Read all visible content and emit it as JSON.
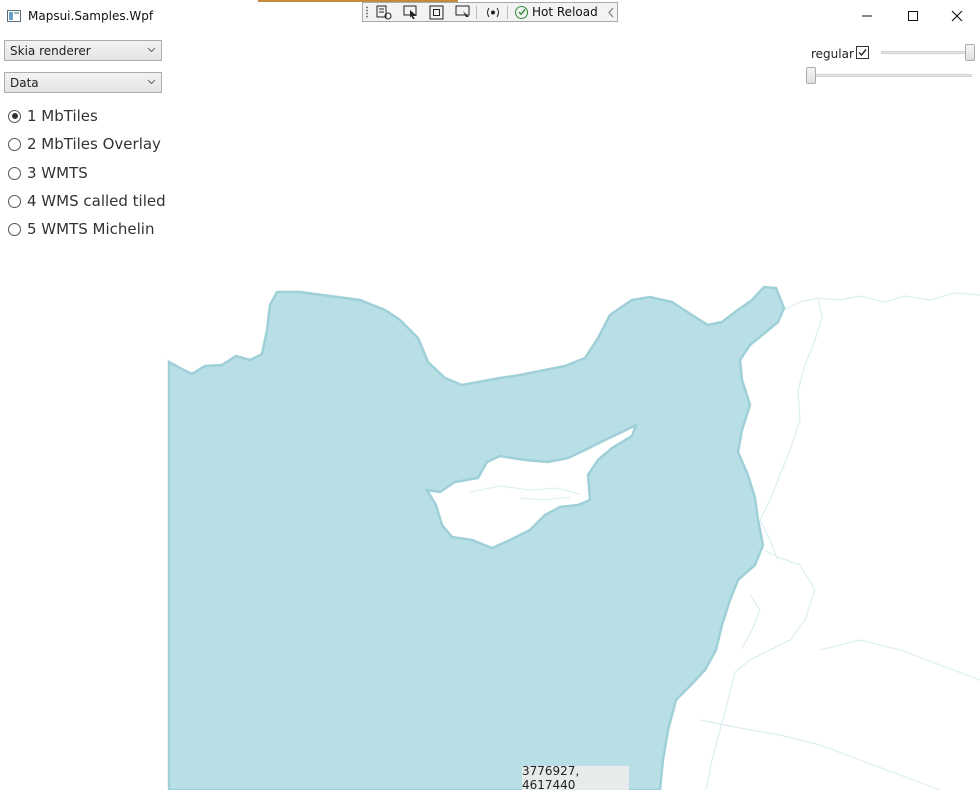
{
  "window": {
    "title": "Mapsui.Samples.Wpf",
    "minimize": "minimize-icon",
    "maximize": "maximize-icon",
    "close": "close-icon"
  },
  "debug_toolbar": {
    "hot_reload_label": "Hot Reload",
    "icons": [
      "live-visual-tree-icon",
      "select-element-icon",
      "display-layout-adorners-icon",
      "track-focus-icon",
      "binding-failures-icon",
      "hot-reload-check-icon",
      "collapse-chevron-icon"
    ]
  },
  "sidebar": {
    "renderer_combo": {
      "value": "Skia renderer"
    },
    "category_combo": {
      "value": "Data"
    },
    "samples": [
      {
        "label": "1 MbTiles",
        "selected": true
      },
      {
        "label": "2 MbTiles Overlay",
        "selected": false
      },
      {
        "label": "3 WMTS",
        "selected": false
      },
      {
        "label": "4 WMS called tiled",
        "selected": false
      },
      {
        "label": "5 WMTS Michelin",
        "selected": false
      }
    ]
  },
  "map_controls": {
    "regular_label": "regular",
    "regular_checked": true,
    "top_slider_value": 1.0,
    "bottom_slider_value": 0.0
  },
  "map": {
    "sea_color": "#b8dfe5",
    "coast_color": "#9fd0d8",
    "border_color": "#dbeef0",
    "coordinates": "3776927, 4617440"
  }
}
